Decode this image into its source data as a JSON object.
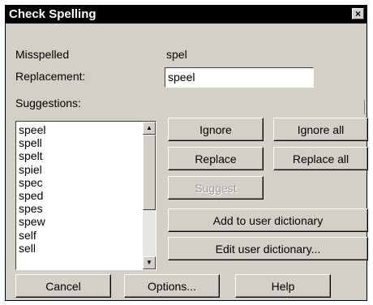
{
  "dialog": {
    "title": "Check Spelling",
    "close_icon": "×",
    "misspelled_label": "Misspelled",
    "misspelled_value": "spel",
    "replacement_label": "Replacement:",
    "replacement_value": "speel",
    "suggestions_label": "Suggestions:",
    "suggestions": [
      "speel",
      "spell",
      "spelt",
      "spiel",
      "spec",
      "sped",
      "spes",
      "spew",
      "self",
      "sell"
    ],
    "scroll_up_icon": "▲",
    "scroll_down_icon": "▼",
    "buttons": {
      "ignore": "Ignore",
      "ignore_all": "Ignore all",
      "replace": "Replace",
      "replace_all": "Replace all",
      "suggest": "Suggest",
      "add_to_dict": "Add to user dictionary",
      "edit_dict": "Edit user dictionary...",
      "cancel": "Cancel",
      "options": "Options...",
      "help": "Help"
    }
  }
}
